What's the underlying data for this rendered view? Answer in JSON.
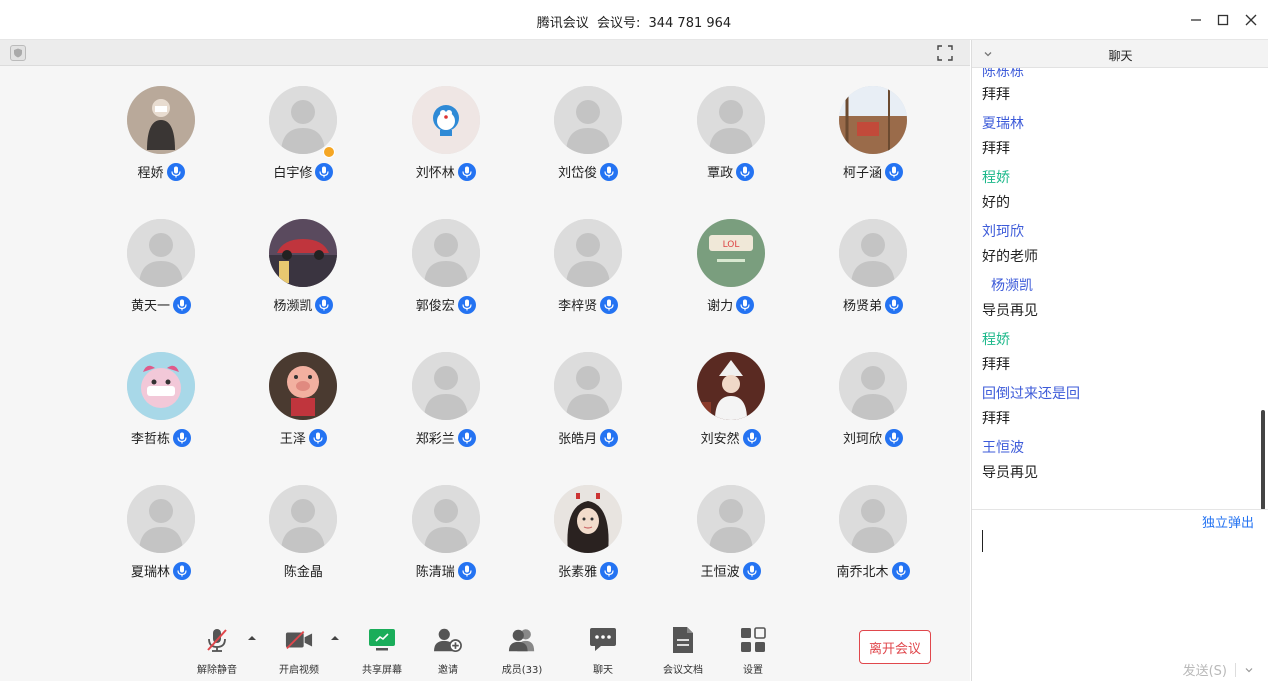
{
  "window": {
    "app_name": "腾讯会议",
    "meeting_label": "会议号:",
    "meeting_id": "344 781 964"
  },
  "participants": [
    {
      "name": "程娇",
      "avatar": "photo-kid",
      "mic": true
    },
    {
      "name": "白宇修",
      "avatar": "default",
      "mic": true,
      "host": true
    },
    {
      "name": "刘怀林",
      "avatar": "doraemon",
      "mic": true
    },
    {
      "name": "刘岱俊",
      "avatar": "default",
      "mic": true
    },
    {
      "name": "覃政",
      "avatar": "default",
      "mic": true
    },
    {
      "name": "柯子涵",
      "avatar": "photo-window",
      "mic": true
    },
    {
      "name": "黄天一",
      "avatar": "default",
      "mic": true
    },
    {
      "name": "杨濒凯",
      "avatar": "photo-car",
      "mic": true
    },
    {
      "name": "郭俊宏",
      "avatar": "default",
      "mic": true
    },
    {
      "name": "李梓贤",
      "avatar": "default",
      "mic": true
    },
    {
      "name": "谢力",
      "avatar": "photo-green",
      "mic": true
    },
    {
      "name": "杨贤弟",
      "avatar": "default",
      "mic": true
    },
    {
      "name": "李哲栋",
      "avatar": "photo-cartoon",
      "mic": true
    },
    {
      "name": "王泽",
      "avatar": "photo-pig",
      "mic": true
    },
    {
      "name": "郑彩兰",
      "avatar": "default",
      "mic": true
    },
    {
      "name": "张皓月",
      "avatar": "default",
      "mic": true
    },
    {
      "name": "刘安然",
      "avatar": "photo-girl-hat",
      "mic": true
    },
    {
      "name": "刘珂欣",
      "avatar": "default",
      "mic": true
    },
    {
      "name": "夏瑞林",
      "avatar": "default",
      "mic": true
    },
    {
      "name": "陈金晶",
      "avatar": "default",
      "mic": false
    },
    {
      "name": "陈清瑞",
      "avatar": "default",
      "mic": true
    },
    {
      "name": "张素雅",
      "avatar": "photo-girl",
      "mic": true
    },
    {
      "name": "王恒波",
      "avatar": "default",
      "mic": true
    },
    {
      "name": "南乔北木",
      "avatar": "default",
      "mic": true
    }
  ],
  "toolbar": {
    "unmute": "解除静音",
    "start_video": "开启视频",
    "share_screen": "共享屏幕",
    "invite": "邀请",
    "members": "成员(33)",
    "chat": "聊天",
    "docs": "会议文档",
    "settings": "设置",
    "leave": "离开会议"
  },
  "chat": {
    "title": "聊天",
    "truncated_sender": "陈栋栋",
    "messages": [
      {
        "text": "拜拜"
      },
      {
        "sender": "夏瑞林",
        "color": "#3d5bd9",
        "text": "拜拜"
      },
      {
        "sender": "程娇",
        "color": "#1cb88a",
        "text": "好的"
      },
      {
        "sender": "刘珂欣",
        "color": "#3d5bd9",
        "text": "好的老师"
      },
      {
        "sender": "杨濒凯",
        "color": "#3d5bd9",
        "text": "导员再见",
        "indent": true
      },
      {
        "sender": "程娇",
        "color": "#1cb88a",
        "text": "拜拜"
      },
      {
        "sender": "回倒过来还是回",
        "color": "#3d5bd9",
        "text": "拜拜"
      },
      {
        "sender": "王恒波",
        "color": "#3d5bd9",
        "text": "导员再见"
      }
    ],
    "popout": "独立弹出",
    "send": "发送(S)"
  },
  "colors": {
    "accent": "#2473f2",
    "leave": "#e0474c",
    "share_green": "#1aad5a",
    "mute_red": "#e0474c"
  }
}
